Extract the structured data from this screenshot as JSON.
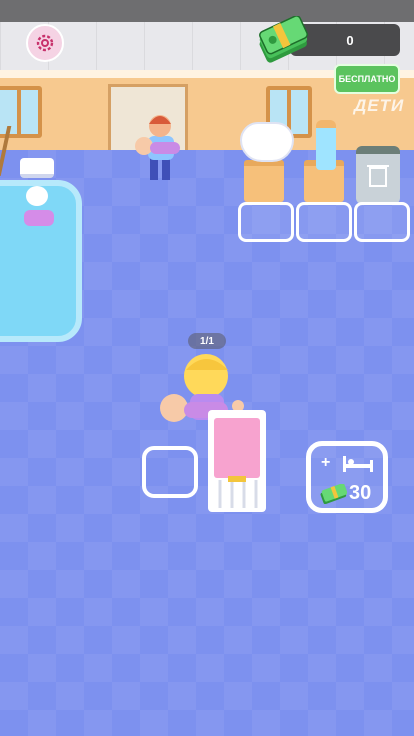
{
  "hud": {
    "money": "0",
    "free_button_label": "БЕСПЛАТНО",
    "settings_icon": "gear-icon",
    "money_icon": "cash-stack-icon"
  },
  "scene": {
    "kids_label": "ДЕТИ",
    "carry_counter": "1/1"
  },
  "buy_crib": {
    "plus": "+",
    "bed_icon": "bed-icon",
    "price": "30"
  },
  "colors": {
    "floor": "#7d91ef",
    "wall": "#f7c98f",
    "accent_green": "#5bc35e",
    "crib_pink": "#f7a3cf"
  }
}
